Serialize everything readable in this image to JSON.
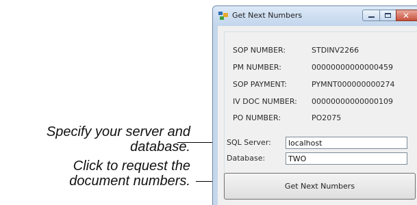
{
  "callouts": {
    "server": {
      "line1": "Specify your server and",
      "line2": "database."
    },
    "request": {
      "line1": "Click to request the",
      "line2": "document numbers."
    }
  },
  "window": {
    "title": "Get Next Numbers",
    "close_glyph": "✕"
  },
  "numbers": [
    {
      "label": "SOP NUMBER:",
      "value": "STDINV2266"
    },
    {
      "label": "PM NUMBER:",
      "value": "00000000000000459"
    },
    {
      "label": "SOP PAYMENT:",
      "value": "PYMNT000000000274"
    },
    {
      "label": "IV DOC NUMBER:",
      "value": "00000000000000109"
    },
    {
      "label": "PO NUMBER:",
      "value": "PO2075"
    }
  ],
  "form": {
    "sql_server_label": "SQL Server:",
    "sql_server_value": "localhost",
    "database_label": "Database:",
    "database_value": "TWO"
  },
  "button": {
    "label": "Get Next Numbers"
  },
  "colors": {
    "title_bar": "#c3d6ec",
    "client_bg": "#f0f0f0",
    "close_button": "#c7503c"
  },
  "icons": {
    "app": "window-app-icon",
    "minimize": "minimize-icon",
    "maximize": "maximize-icon",
    "close": "close-icon"
  }
}
